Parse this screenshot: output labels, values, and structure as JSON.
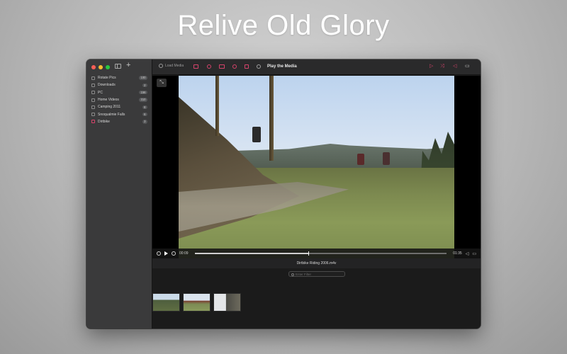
{
  "headline": "Relive Old Glory",
  "sidebar": {
    "items": [
      {
        "name": "Rotate Pics",
        "count": "100"
      },
      {
        "name": "Downloads",
        "count": "2"
      },
      {
        "name": "PC",
        "count": "156"
      },
      {
        "name": "Home Videos",
        "count": "310"
      },
      {
        "name": "Camping 2011",
        "count": "8"
      },
      {
        "name": "Snoqualmie Falls",
        "count": "6"
      },
      {
        "name": "Dirtbike",
        "count": "3"
      }
    ]
  },
  "toolbar": {
    "load_label": "Load Media",
    "play_label": "Play the Media",
    "accent_color": "#d6436b"
  },
  "player": {
    "current_time": "00:09",
    "total_time": "01:35",
    "progress": 0.45
  },
  "media_title": "Dirtbike Riding 2006.m4v",
  "filter": {
    "placeholder": "Enter Filter"
  }
}
